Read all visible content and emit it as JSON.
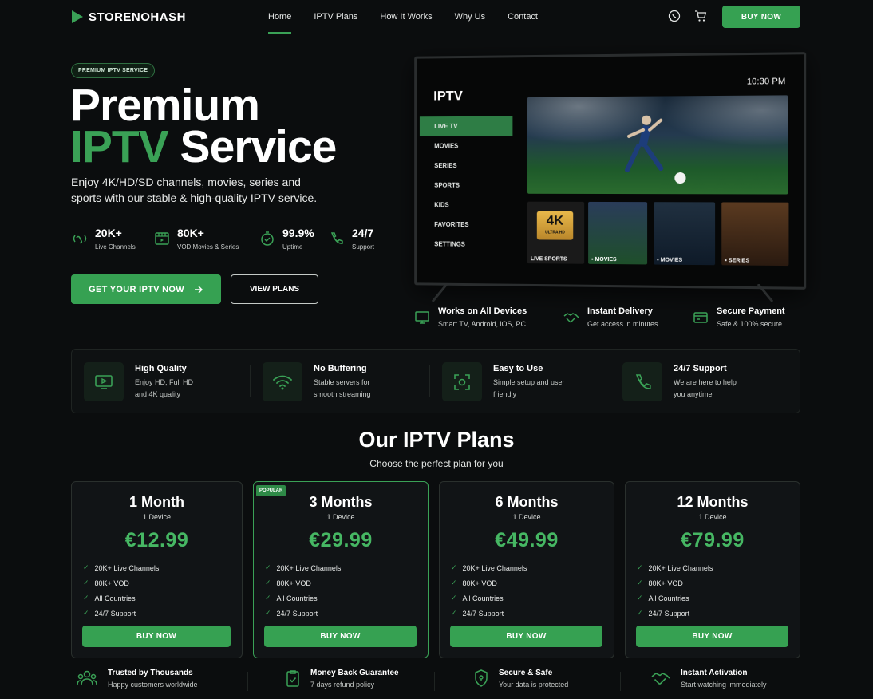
{
  "brand": {
    "name": "STORENOHASH"
  },
  "nav": {
    "links": [
      "Home",
      "IPTV Plans",
      "How It Works",
      "Why Us",
      "Contact"
    ],
    "buy_label": "BUY NOW"
  },
  "hero": {
    "badge": "PREMIUM IPTV SERVICE",
    "title_line1": "Premium",
    "title_accent": "IPTV",
    "title_rest": "Service",
    "description": "Enjoy 4K/HD/SD channels, movies, series and sports with our stable & high-quality IPTV service.",
    "stats": [
      {
        "value": "20K+",
        "label": "Live Channels",
        "icon": "broadcast-icon"
      },
      {
        "value": "80K+",
        "label": "VOD Movies & Series",
        "icon": "film-icon"
      },
      {
        "value": "99.9%",
        "label": "Uptime",
        "icon": "uptime-icon"
      },
      {
        "value": "24/7",
        "label": "Support",
        "icon": "phone-icon"
      }
    ],
    "cta_primary": "GET YOUR IPTV NOW",
    "cta_secondary": "VIEW PLANS"
  },
  "tv": {
    "brand": "IPTV",
    "time": "10:30 PM",
    "menu": [
      "LIVE TV",
      "MOVIES",
      "SERIES",
      "SPORTS",
      "KIDS",
      "FAVORITES",
      "SETTINGS"
    ],
    "tile_4k": "4K",
    "tile_4k_sub": "ULTRA HD",
    "tiles": [
      "LIVE SPORTS",
      "MOVIES",
      "MOVIES",
      "SERIES"
    ]
  },
  "tv_features": [
    {
      "title": "Works on All Devices",
      "desc": "Smart TV, Android, iOS, PC...",
      "icon": "monitor-icon"
    },
    {
      "title": "Instant Delivery",
      "desc": "Get access in minutes",
      "icon": "handshake-icon"
    },
    {
      "title": "Secure Payment",
      "desc": "Safe & 100% secure",
      "icon": "card-icon"
    }
  ],
  "quality": [
    {
      "title": "High Quality",
      "desc": "Enjoy HD, Full HD and 4K quality",
      "icon": "tv-play-icon"
    },
    {
      "title": "No Buffering",
      "desc": "Stable servers for smooth streaming",
      "icon": "wifi-icon"
    },
    {
      "title": "Easy to Use",
      "desc": "Simple setup and user friendly",
      "icon": "scan-icon"
    },
    {
      "title": "24/7 Support",
      "desc": "We are here to help you anytime",
      "icon": "phone-icon"
    }
  ],
  "plans_section": {
    "title": "Our IPTV Plans",
    "subtitle": "Choose the perfect plan for you",
    "popular_label": "POPULAR",
    "plans": [
      {
        "name": "1 Month",
        "devices": "1 Device",
        "price": "€12.99",
        "features": [
          "20K+ Live Channels",
          "80K+ VOD",
          "All Countries",
          "24/7 Support"
        ],
        "buy": "BUY NOW"
      },
      {
        "name": "3 Months",
        "devices": "1 Device",
        "price": "€29.99",
        "features": [
          "20K+ Live Channels",
          "80K+ VOD",
          "All Countries",
          "24/7 Support"
        ],
        "buy": "BUY NOW"
      },
      {
        "name": "6 Months",
        "devices": "1 Device",
        "price": "€49.99",
        "features": [
          "20K+ Live Channels",
          "80K+ VOD",
          "All Countries",
          "24/7 Support"
        ],
        "buy": "BUY NOW"
      },
      {
        "name": "12 Months",
        "devices": "1 Device",
        "price": "€79.99",
        "features": [
          "20K+ Live Channels",
          "80K+ VOD",
          "All Countries",
          "24/7 Support"
        ],
        "buy": "BUY NOW"
      }
    ]
  },
  "trust": [
    {
      "title": "Trusted by Thousands",
      "desc": "Happy customers worldwide",
      "icon": "users-icon"
    },
    {
      "title": "Money Back Guarantee",
      "desc": "7 days refund policy",
      "icon": "clipboard-check-icon"
    },
    {
      "title": "Secure & Safe",
      "desc": "Your data is protected",
      "icon": "shield-icon"
    },
    {
      "title": "Instant Activation",
      "desc": "Start watching immediately",
      "icon": "handshake-icon"
    }
  ],
  "colors": {
    "accent": "#3aa156",
    "price": "#46b763",
    "background": "#0b0d0e"
  }
}
